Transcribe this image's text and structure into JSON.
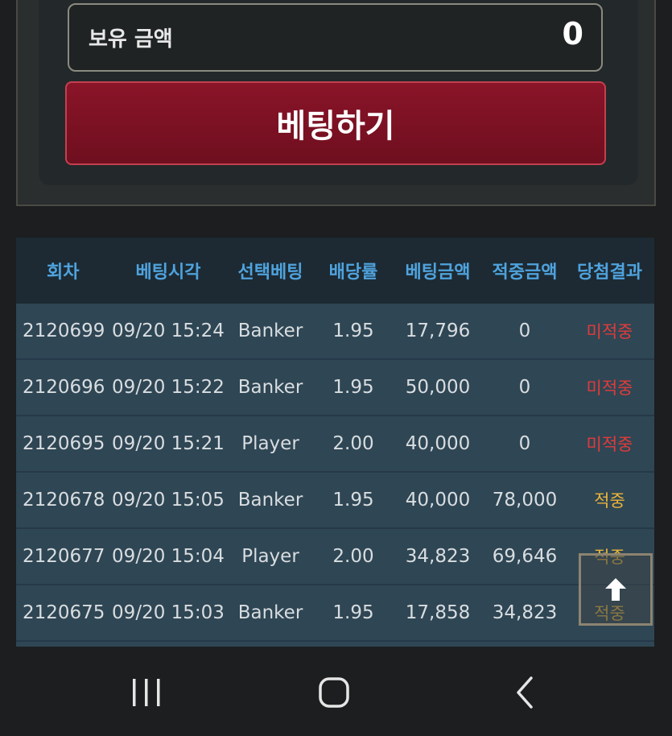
{
  "balance": {
    "label": "보유 금액",
    "value": "0"
  },
  "bet_button": {
    "label": "베팅하기"
  },
  "table": {
    "headers": [
      "회차",
      "베팅시각",
      "선택베팅",
      "배당률",
      "베팅금액",
      "적중금액",
      "당첨결과"
    ],
    "rows": [
      [
        "2120699",
        "09/20 15:24",
        "Banker",
        "1.95",
        "17,796",
        "0",
        "미적중"
      ],
      [
        "2120696",
        "09/20 15:22",
        "Banker",
        "1.95",
        "50,000",
        "0",
        "미적중"
      ],
      [
        "2120695",
        "09/20 15:21",
        "Player",
        "2.00",
        "40,000",
        "0",
        "미적중"
      ],
      [
        "2120678",
        "09/20 15:05",
        "Banker",
        "1.95",
        "40,000",
        "78,000",
        "적중"
      ],
      [
        "2120677",
        "09/20 15:04",
        "Player",
        "2.00",
        "34,823",
        "69,646",
        "적중"
      ],
      [
        "2120675",
        "09/20 15:03",
        "Banker",
        "1.95",
        "17,858",
        "34,823",
        "적중"
      ]
    ]
  },
  "icons": {
    "scroll_top": "arrow-up-icon",
    "nav_recent": "recent-apps-icon",
    "nav_home": "home-icon",
    "nav_back": "back-icon"
  },
  "colors": {
    "lose": "#e23b3b",
    "win": "#e9b43a",
    "header_text": "#4fa3de",
    "bet_button": "#8a1428"
  }
}
